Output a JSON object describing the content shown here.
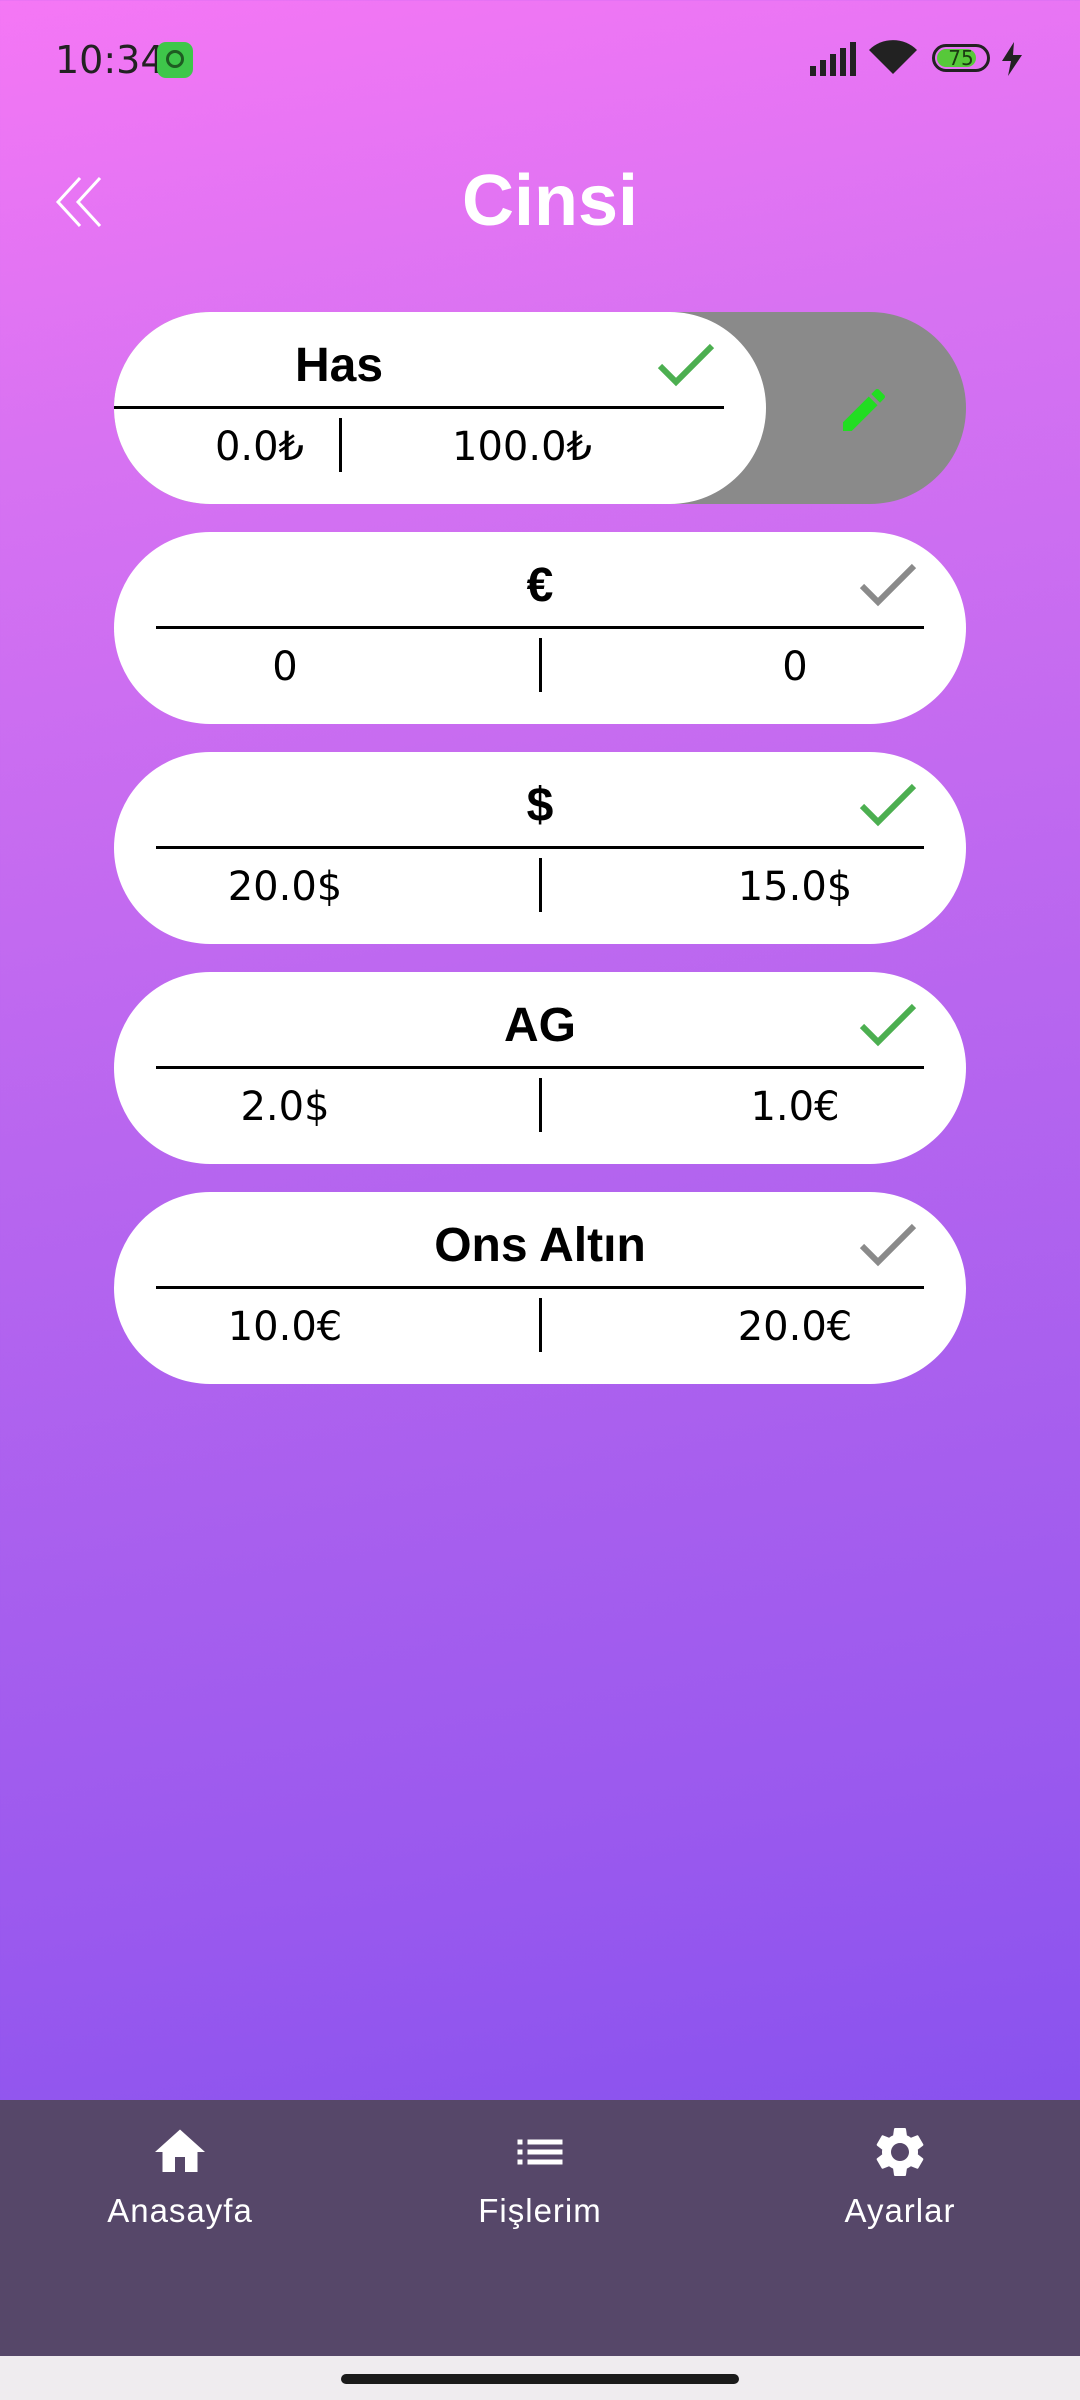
{
  "status_bar": {
    "time": "10:34",
    "battery": "75"
  },
  "header": {
    "title": "Cinsi"
  },
  "items": [
    {
      "name": "Has",
      "left_value": "0.0₺",
      "right_value": "100.0₺",
      "enabled": true,
      "edit_action": "edit"
    },
    {
      "name": "€",
      "left_value": "0",
      "right_value": "0",
      "enabled": false
    },
    {
      "name": "$",
      "left_value": "20.0$",
      "right_value": "15.0$",
      "enabled": true
    },
    {
      "name": "AG",
      "left_value": "2.0$",
      "right_value": "1.0€",
      "enabled": true
    },
    {
      "name": "Ons Altın",
      "left_value": "10.0€",
      "right_value": "20.0€",
      "enabled": false
    }
  ],
  "colors": {
    "check_enabled": "#4caf50",
    "check_disabled": "#8a8a8a",
    "edit_icon": "#22dd22",
    "nav_bg": "#564769"
  },
  "bottom_nav": [
    {
      "label": "Anasayfa",
      "icon": "home-icon"
    },
    {
      "label": "Fişlerim",
      "icon": "list-icon"
    },
    {
      "label": "Ayarlar",
      "icon": "gear-icon"
    }
  ]
}
